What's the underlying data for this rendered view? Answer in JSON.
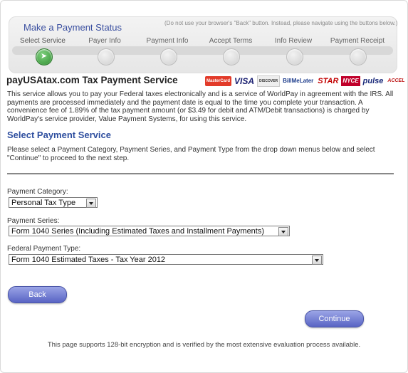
{
  "status": {
    "title": "Make a Payment Status",
    "note": "(Do not use your browser's \"Back\" button. Instead, please navigate using the buttons below.)",
    "steps": [
      {
        "label": "Select Service",
        "active": true
      },
      {
        "label": "Payer Info",
        "active": false
      },
      {
        "label": "Payment Info",
        "active": false
      },
      {
        "label": "Accept Terms",
        "active": false
      },
      {
        "label": "Info Review",
        "active": false
      },
      {
        "label": "Payment Receipt",
        "active": false
      }
    ]
  },
  "service": {
    "title": "payUSAtax.com Tax Payment Service",
    "card_logos": {
      "mastercard": "MasterCard",
      "visa": "VISA",
      "discover": "DISCOVER",
      "billmelater": "BillMeLater",
      "star": "STAR",
      "nyce": "NYCE",
      "pulse": "pulse",
      "accel": "ACCEL"
    },
    "description": "This service allows you to pay your Federal taxes electronically and is a service of WorldPay in agreement with the IRS. All payments are processed immediately and the payment date is equal to the time you complete your transaction. A convenience fee of 1.89% of the tax payment amount (or $3.49 for debit and ATM/Debit transactions) is charged by WorldPay's service provider, Value Payment Systems, for using this service."
  },
  "select_section": {
    "title": "Select Payment Service",
    "instructions": "Please select a Payment Category, Payment Series, and Payment Type from the drop down menus below and select \"Continue\" to proceed to the next step."
  },
  "form": {
    "category_label": "Payment Category:",
    "category_value": "Personal Tax Type",
    "series_label": "Payment Series:",
    "series_value": "Form 1040 Series (Including Estimated Taxes and Installment Payments)",
    "type_label": "Federal Payment Type:",
    "type_value": "Form 1040 Estimated Taxes - Tax Year 2012"
  },
  "buttons": {
    "back": "Back",
    "continue": "Continue"
  },
  "footer": "This page supports 128-bit encryption and is verified by the most extensive evaluation process available."
}
